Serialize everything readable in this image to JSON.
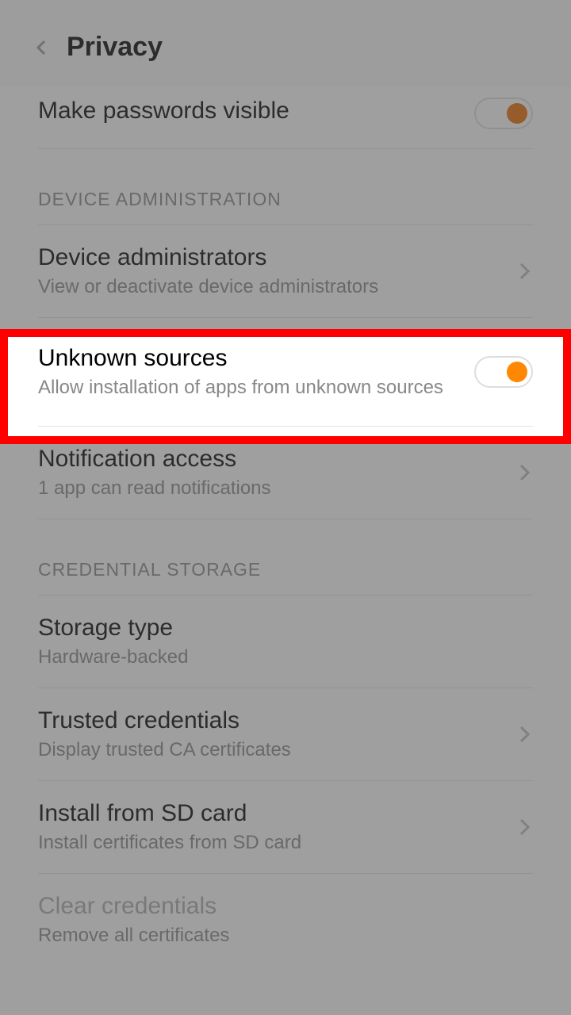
{
  "header": {
    "title": "Privacy"
  },
  "items": {
    "passwords": {
      "title": "Make passwords visible"
    },
    "deviceAdminSection": "DEVICE ADMINISTRATION",
    "deviceAdmin": {
      "title": "Device administrators",
      "subtitle": "View or deactivate device administrators"
    },
    "unknownSources": {
      "title": "Unknown sources",
      "subtitle": "Allow installation of apps from unknown sources"
    },
    "notificationAccess": {
      "title": "Notification access",
      "subtitle": "1 app can read notifications"
    },
    "credentialSection": "CREDENTIAL STORAGE",
    "storageType": {
      "title": "Storage type",
      "subtitle": "Hardware-backed"
    },
    "trustedCredentials": {
      "title": "Trusted credentials",
      "subtitle": "Display trusted CA certificates"
    },
    "installSd": {
      "title": "Install from SD card",
      "subtitle": "Install certificates from SD card"
    },
    "clearCredentials": {
      "title": "Clear credentials",
      "subtitle": "Remove all certificates"
    }
  }
}
